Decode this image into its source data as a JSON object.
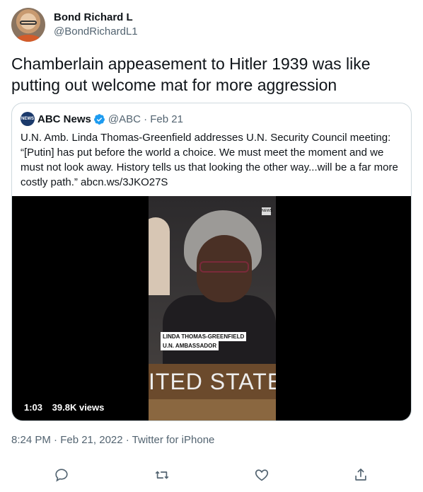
{
  "author": {
    "display_name": "Bond Richard L",
    "handle": "@BondRichardL1"
  },
  "tweet": {
    "text": "Chamberlain appeasement to Hitler 1939 was like putting out welcome mat for more aggression",
    "timestamp": "8:24 PM · Feb 21, 2022 · Twitter for iPhone"
  },
  "quoted": {
    "logo_text": "NEWS",
    "name": "ABC News",
    "handle_date": "@ABC · Feb 21",
    "text": "U.N. Amb. Linda Thomas-Greenfield addresses U.N. Security Council meeting: “[Putin] has put before the world a choice. We must meet the moment and we must not look away. History tells us that looking the other way...will be a far more costly path.” abcn.ws/3JKO27S",
    "video": {
      "caption_line1": "LINDA THOMAS-GREENFIELD",
      "caption_line2": "U.N. AMBASSADOR",
      "nameplate": "ITED  STATE",
      "watermark": "NEWS",
      "duration": "1:03",
      "views": "39.8K views"
    }
  },
  "actions": [
    "reply-icon",
    "retweet-icon",
    "like-icon",
    "share-icon"
  ],
  "colors": {
    "text": "#0f1419",
    "secondary": "#536471",
    "border": "#cfd9de",
    "verified": "#1d9bf0"
  }
}
